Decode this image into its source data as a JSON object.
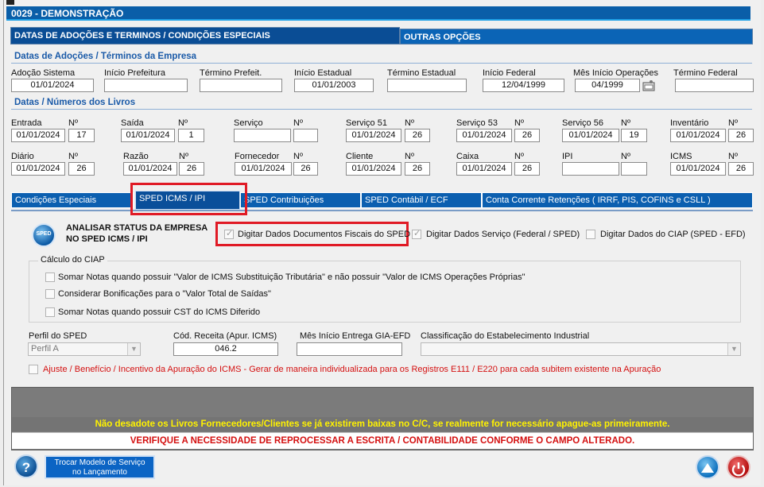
{
  "window": {
    "title": "0029   -  DEMONSTRAÇÃO"
  },
  "main_tabs": [
    {
      "label": "DATAS DE ADOÇÕES E TERMINOS / CONDIÇÕES ESPECIAIS"
    },
    {
      "label": "OUTRAS OPÇÕES"
    }
  ],
  "adocoes": {
    "title": "Datas de Adoções / Términos da Empresa",
    "fields": [
      {
        "label": "Adoção Sistema",
        "value": "01/01/2024"
      },
      {
        "label": "Início Prefeitura",
        "value": ""
      },
      {
        "label": "Término Prefeit.",
        "value": ""
      },
      {
        "label": "Início Estadual",
        "value": "01/01/2003"
      },
      {
        "label": "Término Estadual",
        "value": ""
      },
      {
        "label": "Início Federal",
        "value": "12/04/1999"
      },
      {
        "label": "Mês Início Operações",
        "value": "04/1999"
      },
      {
        "label": "Término Federal",
        "value": ""
      }
    ]
  },
  "livros": {
    "title": "Datas / Números dos Livros",
    "row1": [
      {
        "label": "Entrada",
        "date": "01/01/2024",
        "nlabel": "Nº",
        "num": "17"
      },
      {
        "label": "Saída",
        "date": "01/01/2024",
        "nlabel": "Nº",
        "num": "1"
      },
      {
        "label": "Serviço",
        "date": "",
        "nlabel": "Nº",
        "num": ""
      },
      {
        "label": "Serviço 51",
        "date": "01/01/2024",
        "nlabel": "Nº",
        "num": "26"
      },
      {
        "label": "Serviço 53",
        "date": "01/01/2024",
        "nlabel": "Nº",
        "num": "26"
      },
      {
        "label": "Serviço 56",
        "date": "01/01/2024",
        "nlabel": "Nº",
        "num": "19"
      },
      {
        "label": "Inventário",
        "date": "01/01/2024",
        "nlabel": "Nº",
        "num": "26"
      }
    ],
    "row2": [
      {
        "label": "Diário",
        "date": "01/01/2024",
        "nlabel": "Nº",
        "num": "26"
      },
      {
        "label": "Razão",
        "date": "01/01/2024",
        "nlabel": "Nº",
        "num": "26"
      },
      {
        "label": "Fornecedor",
        "date": "01/01/2024",
        "nlabel": "Nº",
        "num": "26"
      },
      {
        "label": "Cliente",
        "date": "01/01/2024",
        "nlabel": "Nº",
        "num": "26"
      },
      {
        "label": "Caixa",
        "date": "01/01/2024",
        "nlabel": "Nº",
        "num": "26"
      },
      {
        "label": "IPI",
        "date": "",
        "nlabel": "Nº",
        "num": ""
      },
      {
        "label": "ICMS",
        "date": "01/01/2024",
        "nlabel": "Nº",
        "num": "26"
      }
    ]
  },
  "sub_tabs": [
    {
      "label": "Condições Especiais"
    },
    {
      "label": "SPED ICMS / IPI"
    },
    {
      "label": "SPED Contribuições"
    },
    {
      "label": "SPED Contábil / ECF"
    },
    {
      "label": "Conta Corrente Retenções  ( IRRF,  PIS,  COFINS  e  CSLL )"
    }
  ],
  "sped": {
    "icon_text": "SPED",
    "analisar_line1": "ANALISAR STATUS DA EMPRESA",
    "analisar_line2": "NO SPED ICMS / IPI",
    "chk_docs": "Digitar Dados Documentos Fiscais do SPED",
    "chk_servico": "Digitar Dados Serviço (Federal / SPED)",
    "chk_ciap": "Digitar Dados do CIAP (SPED - EFD)",
    "ciap_legend": "Cálculo do CIAP",
    "ciap_opts": [
      "Somar Notas quando possuir \"Valor de ICMS Substituição Tributária\" e não possuir \"Valor de ICMS Operações Próprias\"",
      "Considerar Bonificações para o \"Valor Total de Saídas\"",
      "Somar Notas quando possuir CST do ICMS Diferido"
    ],
    "perfil_label": "Perfil do SPED",
    "perfil_value": "Perfil A",
    "receita_label": "Cód. Receita (Apur. ICMS)",
    "receita_value": "046.2",
    "gia_label": "Mês Início Entrega GIA-EFD",
    "gia_value": "",
    "classif_label": "Classificação do Estabelecimento Industrial",
    "classif_value": "",
    "ajuste": "Ajuste / Benefício / Incentivo da Apuração do ICMS - Gerar de maneira individualizada para os Registros E111 / E220 para cada subitem existente na Apuração"
  },
  "warnings": {
    "line1": "Não desadote os Livros Fornecedores/Clientes se já existirem baixas no C/C, se realmente for necessário apague-as primeiramente.",
    "line2": "VERIFIQUE A NECESSIDADE DE REPROCESSAR A ESCRITA / CONTABILIDADE CONFORME O CAMPO ALTERADO."
  },
  "footer": {
    "help": "?",
    "trocar_line1": "Trocar Modelo de Serviço",
    "trocar_line2": "no Lançamento"
  },
  "colors": {
    "title_bar": "#0a5ea8",
    "tab_blue": "#0b5fb0",
    "highlight_red": "#e01a25",
    "warn_yellow": "#fff200",
    "warn_red": "#d41010"
  }
}
